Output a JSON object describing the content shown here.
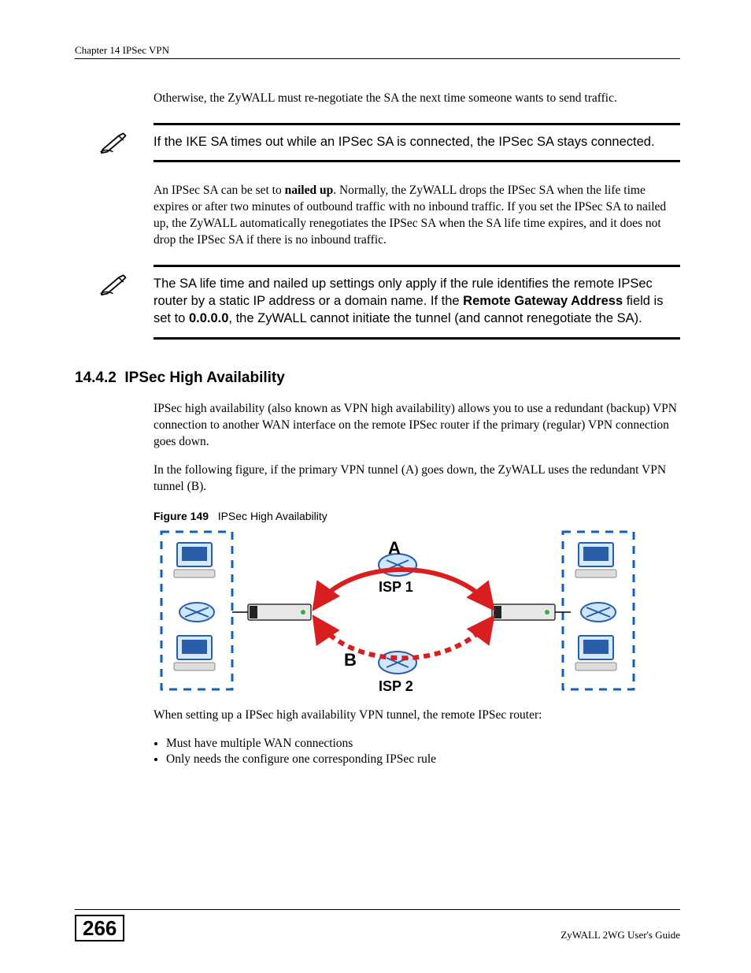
{
  "header": {
    "chapter": "Chapter 14 IPSec VPN"
  },
  "para_intro": "Otherwise, the ZyWALL must re-negotiate the SA the next time someone wants to send traffic.",
  "note1": "If the IKE SA times out while an IPSec SA is connected, the IPSec SA stays connected.",
  "para_nailed": {
    "pre": "An IPSec SA can be set to ",
    "bold1": "nailed up",
    "post": ". Normally, the ZyWALL drops the IPSec SA when the life time expires or after two minutes of outbound traffic with no inbound traffic. If you set the IPSec SA to nailed up, the ZyWALL automatically renegotiates the IPSec SA when the SA life time expires, and it does not drop the IPSec SA if there is no inbound traffic."
  },
  "note2": {
    "part1": "The SA life time and nailed up settings only apply if the rule identifies the remote IPSec router by a static IP address or a domain name. If the ",
    "bold1": "Remote Gateway Address",
    "part2": " field is set to ",
    "bold2": "0.0.0.0",
    "part3": ", the ZyWALL cannot initiate the tunnel (and cannot renegotiate the SA)."
  },
  "section": {
    "number": "14.4.2",
    "title": "IPSec High Availability"
  },
  "para_ha1": "IPSec high availability (also known as VPN high availability) allows you to use a redundant (backup) VPN connection to another WAN interface on the remote IPSec router if the primary (regular) VPN connection goes down.",
  "para_ha2": "In the following figure, if the primary VPN tunnel (A) goes down, the ZyWALL uses the redundant VPN tunnel (B).",
  "figure": {
    "number": "Figure 149",
    "title": "IPSec High Availability",
    "labels": {
      "A": "A",
      "B": "B",
      "isp1": "ISP 1",
      "isp2": "ISP 2"
    }
  },
  "para_ha3": "When setting up a IPSec high availability VPN tunnel, the remote IPSec router:",
  "bullets": [
    "Must have multiple WAN connections",
    "Only needs the configure one corresponding IPSec rule"
  ],
  "footer": {
    "page_number": "266",
    "guide": "ZyWALL 2WG User's Guide"
  }
}
